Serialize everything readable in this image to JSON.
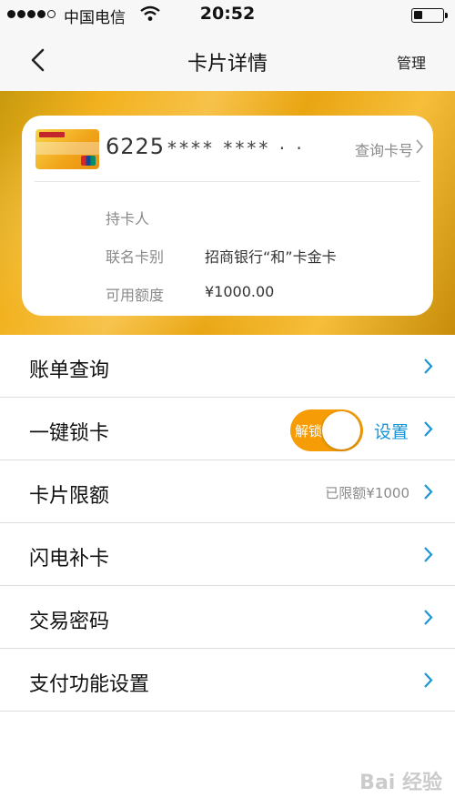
{
  "status_bar": {
    "carrier": "中国电信",
    "time": "20:52",
    "signal_bars": 4,
    "battery_level_fraction": 0.25
  },
  "nav": {
    "title": "卡片详情",
    "manage_label": "管理",
    "back_icon": "chevron-left-icon"
  },
  "card": {
    "number_prefix": "6225",
    "number_masked": "**** **** · ·",
    "query_link": "查询卡号",
    "info": [
      {
        "label": "持卡人",
        "value": ""
      },
      {
        "label": "联名卡别",
        "value": "招商银行“和”卡金卡"
      },
      {
        "label": "可用额度",
        "value": "¥1000.00"
      }
    ]
  },
  "menu": [
    {
      "label": "账单查询"
    },
    {
      "label": "一键锁卡",
      "toggle_text": "解锁",
      "toggle_on": true,
      "action": "设置"
    },
    {
      "label": "卡片限额",
      "hint": "已限额¥1000"
    },
    {
      "label": "闪电补卡"
    },
    {
      "label": "交易密码"
    },
    {
      "label": "支付功能设置"
    }
  ],
  "colors": {
    "accent_blue": "#1a95d6",
    "toggle_orange": "#f59c07",
    "banner_gold": "#f2b11e"
  },
  "watermark": "Bai 经验"
}
